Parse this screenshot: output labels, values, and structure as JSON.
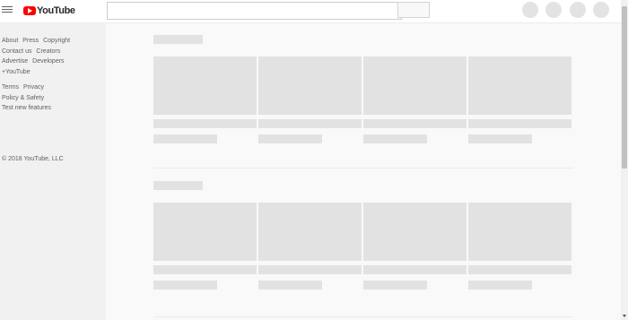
{
  "header": {
    "logo_text": "YouTube",
    "search": {
      "placeholder": "",
      "value": ""
    },
    "icons": [
      "menu-icon",
      "youtube-logo-icon",
      "search-icon",
      "apps-icon",
      "messages-icon",
      "notifications-icon",
      "account-avatar"
    ]
  },
  "sidebar": {
    "links_group_1": [
      "About",
      "Press",
      "Copyright",
      "Contact us",
      "Creators",
      "Advertise",
      "Developers",
      "+YouTube"
    ],
    "links_group_2": [
      "Terms",
      "Privacy",
      "Policy & Safety",
      "Test new features"
    ],
    "copyright": "© 2018 YouTube, LLC"
  },
  "colors": {
    "brand_red": "#ff0000",
    "page_bg": "#f9f9f9",
    "sidebar_bg": "#f1f1f1",
    "placeholder": "#e2e2e2"
  }
}
